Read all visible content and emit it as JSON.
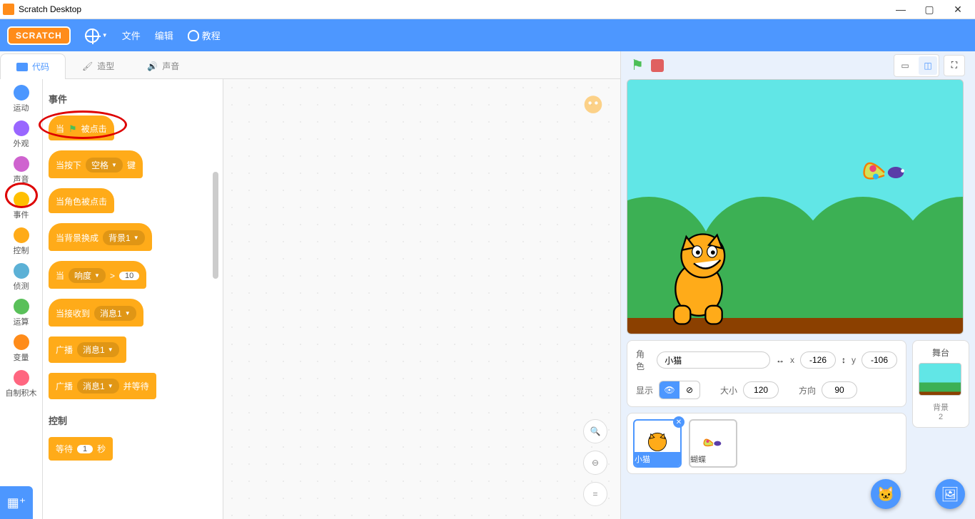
{
  "window": {
    "title": "Scratch Desktop"
  },
  "menu": {
    "logo": "SCRATCH",
    "file": "文件",
    "edit": "编辑",
    "tutorials": "教程"
  },
  "tabs": {
    "code": "代码",
    "costumes": "造型",
    "sounds": "声音"
  },
  "categories": [
    {
      "label": "运动",
      "color": "#4c97ff"
    },
    {
      "label": "外观",
      "color": "#9966ff"
    },
    {
      "label": "声音",
      "color": "#cf63cf"
    },
    {
      "label": "事件",
      "color": "#ffbf00"
    },
    {
      "label": "控制",
      "color": "#ffab19"
    },
    {
      "label": "侦测",
      "color": "#5cb1d6"
    },
    {
      "label": "运算",
      "color": "#59c059"
    },
    {
      "label": "变量",
      "color": "#ff8c1a"
    },
    {
      "label": "自制积木",
      "color": "#ff6680"
    }
  ],
  "palette": {
    "section_events": "事件",
    "section_control": "控制",
    "blocks": {
      "when_flag_l": "当",
      "when_flag_r": "被点击",
      "when_key_l": "当按下",
      "when_key_opt": "空格",
      "when_key_r": "键",
      "when_clicked": "当角色被点击",
      "when_backdrop": "当背景换成",
      "backdrop_opt": "背景1",
      "when_gt_l": "当",
      "gt_opt": "响度",
      "gt_sym": ">",
      "gt_val": "10",
      "when_receive": "当接收到",
      "msg_opt": "消息1",
      "broadcast": "广播",
      "broadcast_wait_l": "广播",
      "broadcast_wait_r": "并等待",
      "wait_l": "等待",
      "wait_val": "1",
      "wait_r": "秒"
    }
  },
  "sprite_info": {
    "label_sprite": "角色",
    "name": "小猫",
    "label_x": "x",
    "x": "-126",
    "label_y": "y",
    "y": "-106",
    "label_show": "显示",
    "label_size": "大小",
    "size": "120",
    "label_direction": "方向",
    "direction": "90"
  },
  "sprites": [
    {
      "name": "小猫"
    },
    {
      "name": "蝴蝶"
    }
  ],
  "stage": {
    "title": "舞台",
    "backdrops_label": "背景",
    "backdrops_count": "2"
  }
}
